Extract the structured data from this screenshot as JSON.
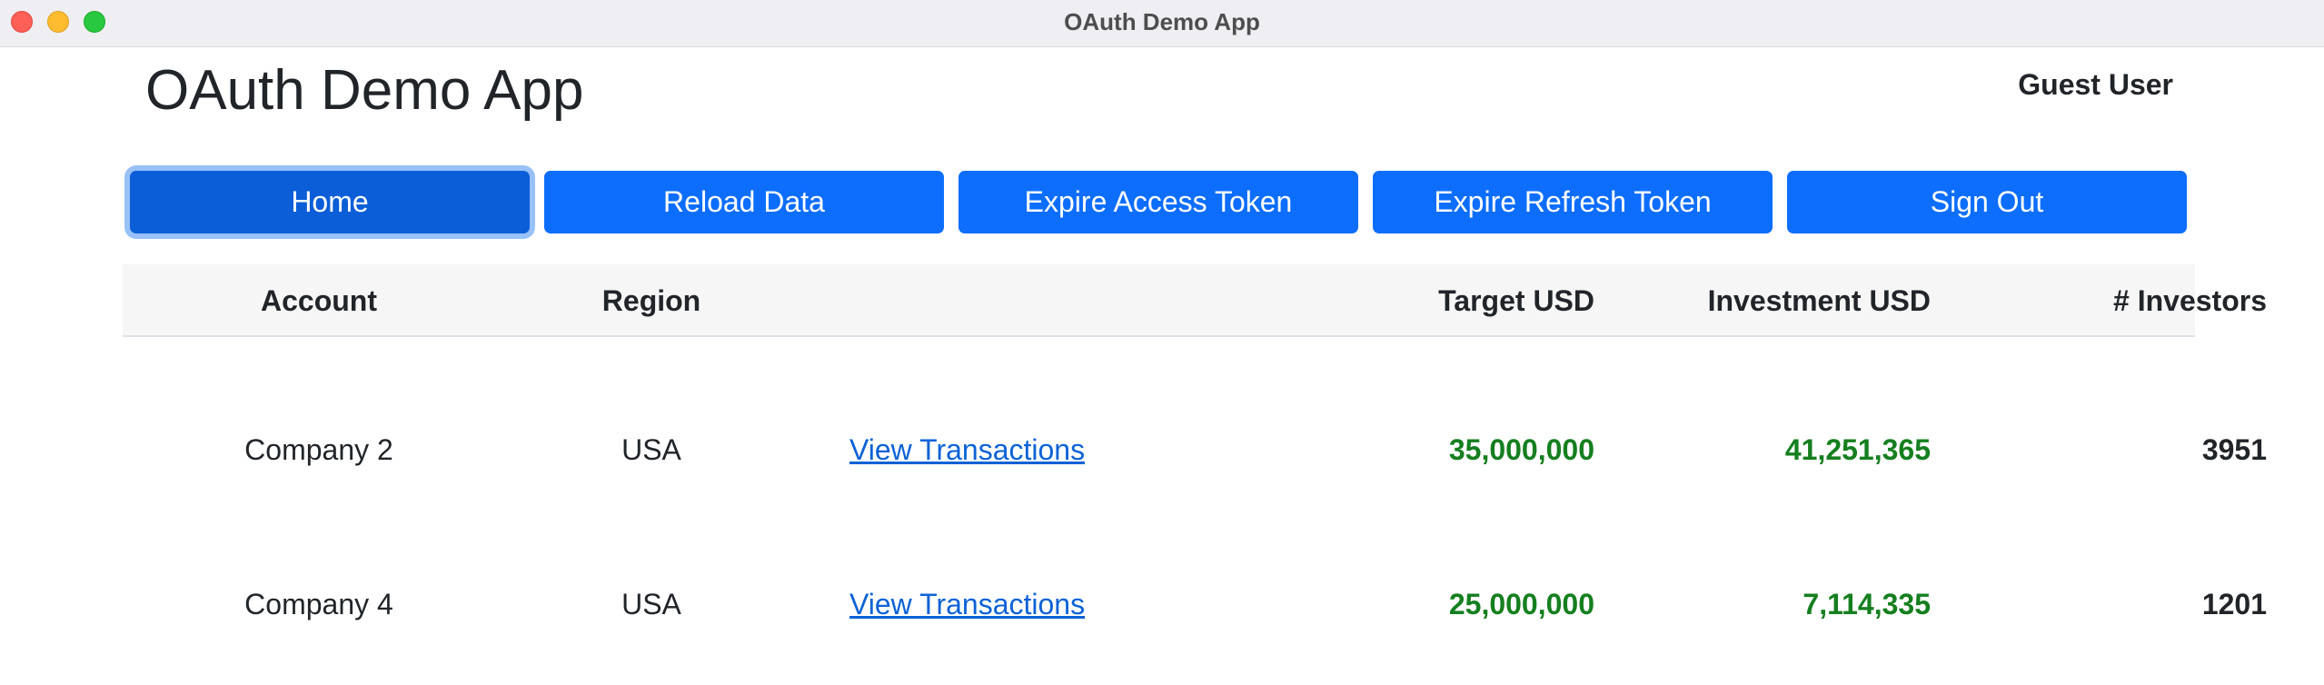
{
  "window": {
    "title": "OAuth Demo App"
  },
  "header": {
    "app_title": "OAuth Demo App",
    "user_name": "Guest User"
  },
  "nav": {
    "buttons": [
      {
        "label": "Home",
        "active": true
      },
      {
        "label": "Reload Data",
        "active": false
      },
      {
        "label": "Expire Access Token",
        "active": false
      },
      {
        "label": "Expire Refresh Token",
        "active": false
      },
      {
        "label": "Sign Out",
        "active": false
      }
    ]
  },
  "table": {
    "columns": [
      "Account",
      "Region",
      "",
      "Target USD",
      "Investment USD",
      "# Investors"
    ],
    "rows": [
      {
        "account": "Company 2",
        "region": "USA",
        "link": "View Transactions",
        "target_usd": "35,000,000",
        "investment_usd": "41,251,365",
        "investors": "3951"
      },
      {
        "account": "Company 4",
        "region": "USA",
        "link": "View Transactions",
        "target_usd": "25,000,000",
        "investment_usd": "7,114,335",
        "investors": "1201"
      }
    ]
  },
  "colors": {
    "primary": "#0d6efd",
    "primary_active": "#0b5ed7",
    "money": "#157f1f",
    "link": "#0b62d6"
  }
}
